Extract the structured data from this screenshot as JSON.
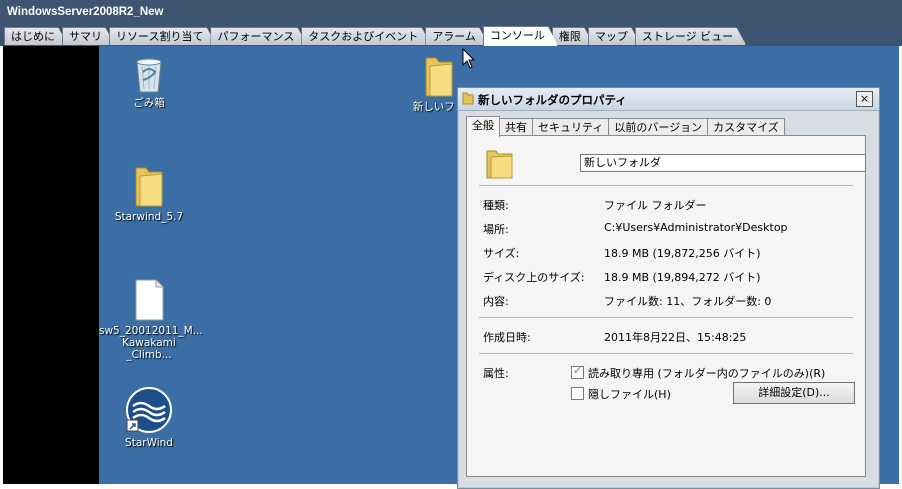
{
  "window": {
    "title": "WindowsServer2008R2_New"
  },
  "tabs": [
    {
      "label": "はじめに"
    },
    {
      "label": "サマリ"
    },
    {
      "label": "リソース割り当て"
    },
    {
      "label": "パフォーマンス"
    },
    {
      "label": "タスクおよびイベント"
    },
    {
      "label": "アラーム"
    },
    {
      "label": "コンソール",
      "active": true
    },
    {
      "label": "権限"
    },
    {
      "label": "マップ"
    },
    {
      "label": "ストレージ ビュー"
    }
  ],
  "desktop": {
    "background_color": "#3a6ea5",
    "icons": [
      {
        "label": "ごみ箱",
        "icon": "recycle-bin-icon"
      },
      {
        "label": "Starwind_5.7",
        "icon": "folder-icon"
      },
      {
        "label": "sw5_20012011_M...",
        "label2": "Kawakami _Climb...",
        "icon": "file-icon"
      },
      {
        "label": "StarWind",
        "icon": "starwind-shortcut-icon"
      },
      {
        "label": "新しいフォ",
        "icon": "folder-icon"
      }
    ]
  },
  "dialog": {
    "title": "新しいフォルダのプロパティ",
    "close": "×",
    "tabs": [
      "全般",
      "共有",
      "セキュリティ",
      "以前のバージョン",
      "カスタマイズ"
    ],
    "active_tab": "全般",
    "name_value": "新しいフォルダ",
    "properties": [
      {
        "label": "種類:",
        "value": "ファイル フォルダー"
      },
      {
        "label": "場所:",
        "value": "C:¥Users¥Administrator¥Desktop"
      },
      {
        "label": "サイズ:",
        "value": "18.9 MB (19,872,256 バイト)"
      },
      {
        "label": "ディスク上のサイズ:",
        "value": "18.9 MB (19,894,272 バイト)"
      },
      {
        "label": "内容:",
        "value": "ファイル数: 11、フォルダー数: 0"
      }
    ],
    "created": {
      "label": "作成日時:",
      "value": "2011年8月22日、15:48:25"
    },
    "attributes": {
      "label": "属性:",
      "readonly": {
        "label": "読み取り専用 (フォルダー内のファイルのみ)(R)",
        "checked": true
      },
      "hidden": {
        "label": "隠しファイル(H)",
        "checked": false
      },
      "advanced_button": "詳細設定(D)..."
    }
  }
}
